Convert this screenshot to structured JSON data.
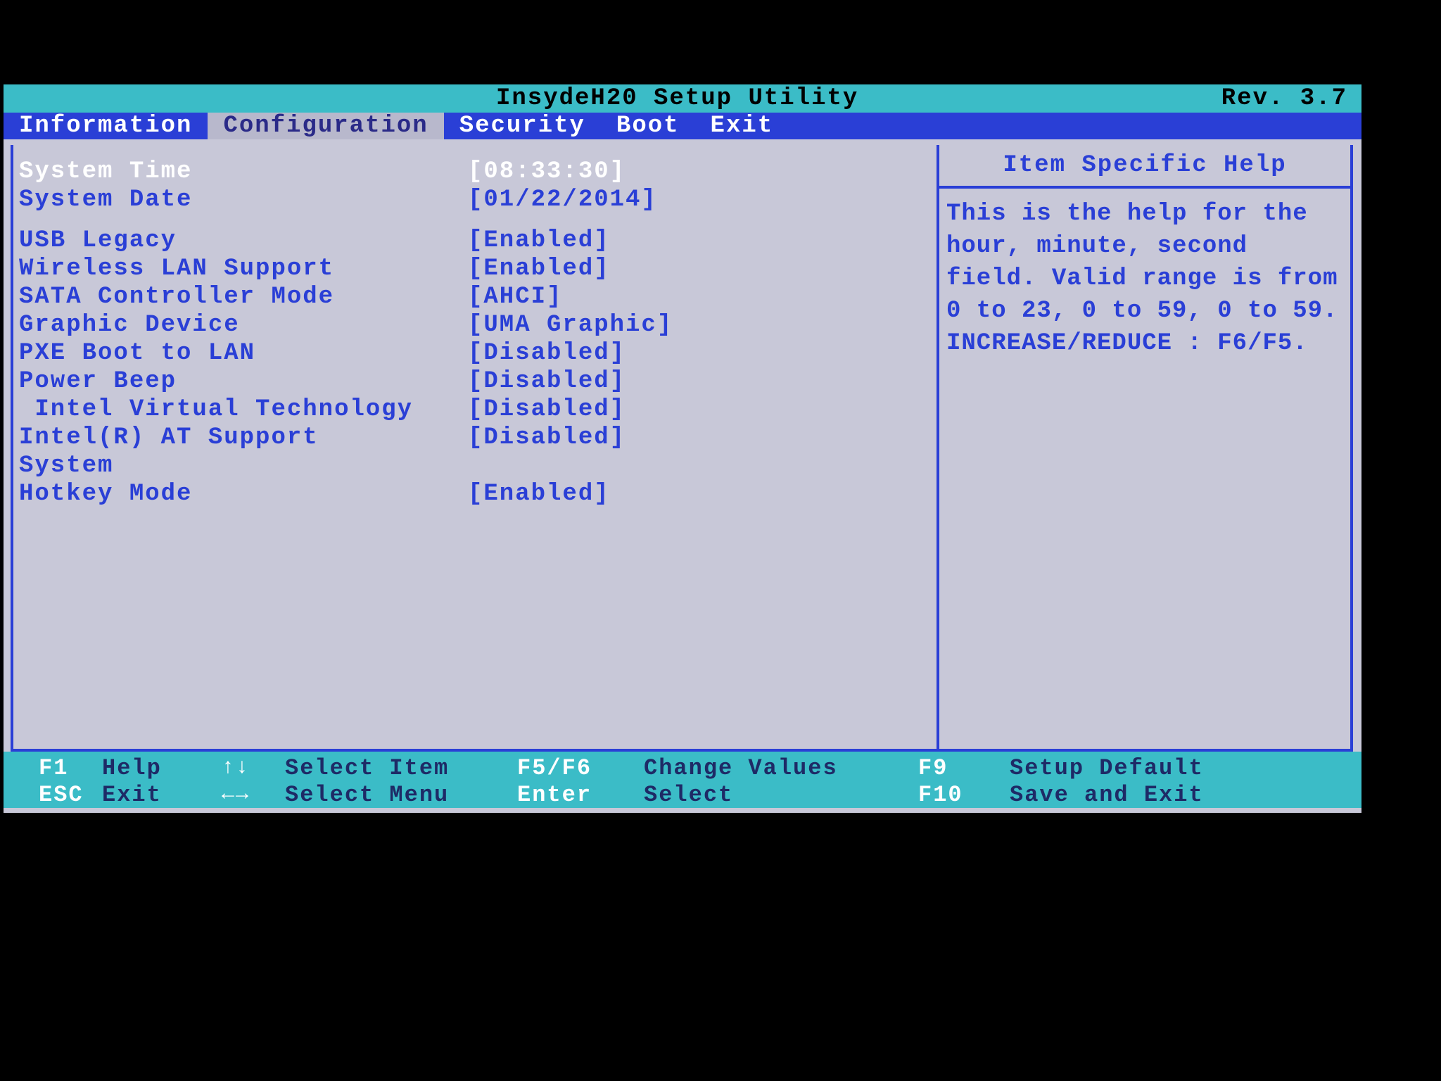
{
  "title": "InsydeH20 Setup Utility",
  "rev": "Rev. 3.7",
  "tabs": {
    "information": "Information",
    "configuration": "Configuration",
    "security": "Security",
    "boot": "Boot",
    "exit": "Exit"
  },
  "settings": {
    "system_time": {
      "label": "System Time",
      "value": "[08:33:30]"
    },
    "system_date": {
      "label": "System Date",
      "value": "[01/22/2014]"
    },
    "usb_legacy": {
      "label": "USB Legacy",
      "value": "[Enabled]"
    },
    "wlan_support": {
      "label": "Wireless LAN Support",
      "value": "[Enabled]"
    },
    "sata_mode": {
      "label": "SATA Controller Mode",
      "value": "[AHCI]"
    },
    "graphic_device": {
      "label": "Graphic Device",
      "value": "[UMA Graphic]"
    },
    "pxe_boot": {
      "label": "PXE Boot to LAN",
      "value": "[Disabled]"
    },
    "power_beep": {
      "label": "Power Beep",
      "value": "[Disabled]"
    },
    "intel_vt": {
      "label": " Intel Virtual Technology",
      "value": "[Disabled]"
    },
    "intel_at": {
      "label": "Intel(R) AT Support",
      "value": "[Disabled]"
    },
    "system": {
      "label": "System",
      "value": ""
    },
    "hotkey_mode": {
      "label": "Hotkey Mode",
      "value": "[Enabled]"
    }
  },
  "help": {
    "title": "Item Specific Help",
    "body": "This is the help for the hour, minute, second field. Valid range is from 0 to 23, 0 to 59, 0 to 59.  INCREASE/REDUCE : F6/F5."
  },
  "footer": {
    "f1": {
      "key": "F1",
      "desc": "Help"
    },
    "esc": {
      "key": "ESC",
      "desc": "Exit"
    },
    "selitem": {
      "desc": "Select Item"
    },
    "selmenu": {
      "desc": "Select Menu"
    },
    "f5f6": {
      "key": "F5/F6",
      "desc": "Change Values"
    },
    "enter": {
      "key": "Enter",
      "desc": "Select"
    },
    "f9": {
      "key": "F9",
      "desc": "Setup Default"
    },
    "f10": {
      "key": "F10",
      "desc": "Save and Exit"
    }
  }
}
